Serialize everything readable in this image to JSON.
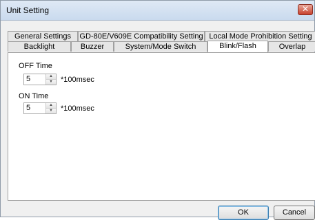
{
  "window": {
    "title": "Unit Setting",
    "close_glyph": "✕"
  },
  "tabs": {
    "row_top": [
      {
        "label": "General Settings"
      },
      {
        "label": "GD-80E/V609E Compatibility Setting"
      },
      {
        "label": "Local Mode Prohibition Setting"
      }
    ],
    "row_bottom": [
      {
        "label": "Backlight"
      },
      {
        "label": "Buzzer"
      },
      {
        "label": "System/Mode Switch"
      },
      {
        "label": "Blink/Flash",
        "active": true
      },
      {
        "label": "Overlap"
      }
    ]
  },
  "blink_flash": {
    "off_time": {
      "label": "OFF Time",
      "value": "5",
      "unit": "*100msec"
    },
    "on_time": {
      "label": "ON Time",
      "value": "5",
      "unit": "*100msec"
    }
  },
  "buttons": {
    "ok": "OK",
    "cancel": "Cancel"
  },
  "icons": {
    "spin_up": "▲",
    "spin_down": "▼"
  }
}
